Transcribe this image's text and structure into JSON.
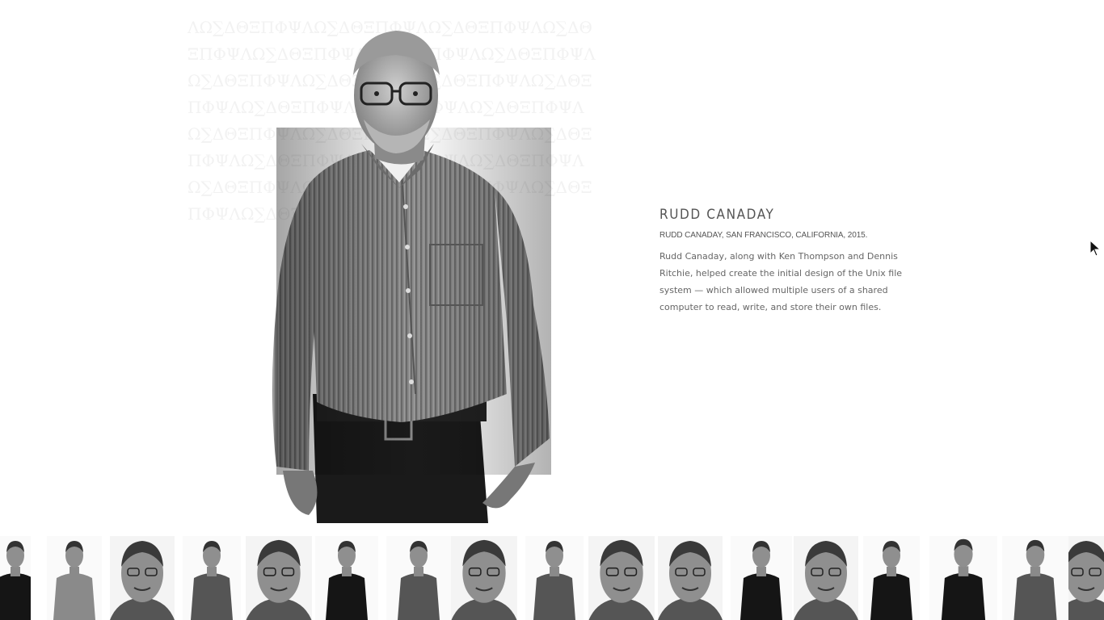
{
  "profile": {
    "name": "RUDD CANADAY",
    "caption": "RUDD CANADAY, SAN FRANCISCO, CALIFORNIA, 2015.",
    "description": "Rudd Canaday, along with Ken Thompson and Dennis Ritchie, helped create the initial design of the Unix file system — which allowed multiple users of a shared computer to read, write, and store their own files."
  },
  "icons": {
    "cursor": "arrow-cursor-icon"
  },
  "thumbnails": [
    {
      "id": "portrait-1",
      "style": "woman-dark"
    },
    {
      "id": "portrait-2",
      "style": "man-plaid"
    },
    {
      "id": "portrait-3",
      "style": "man-closeup"
    },
    {
      "id": "portrait-4",
      "style": "man-bald-small"
    },
    {
      "id": "portrait-5",
      "style": "man-glasses-closeup"
    },
    {
      "id": "portrait-6",
      "style": "woman-glasses"
    },
    {
      "id": "portrait-7",
      "style": "man-small"
    },
    {
      "id": "portrait-8",
      "style": "man-mustache"
    },
    {
      "id": "portrait-9",
      "style": "man-shirt-small"
    },
    {
      "id": "portrait-10",
      "style": "man-glasses-gray"
    },
    {
      "id": "portrait-11",
      "style": "woman-short-hair"
    },
    {
      "id": "portrait-12",
      "style": "man-suit"
    },
    {
      "id": "portrait-13",
      "style": "man-elderly"
    },
    {
      "id": "portrait-14",
      "style": "woman-jacket"
    },
    {
      "id": "portrait-15",
      "style": "woman-curly"
    },
    {
      "id": "portrait-16",
      "style": "man-phone"
    },
    {
      "id": "portrait-17",
      "style": "man-partial"
    }
  ],
  "colors": {
    "text_primary": "#555555",
    "text_secondary": "#666666",
    "background": "#ffffff"
  }
}
